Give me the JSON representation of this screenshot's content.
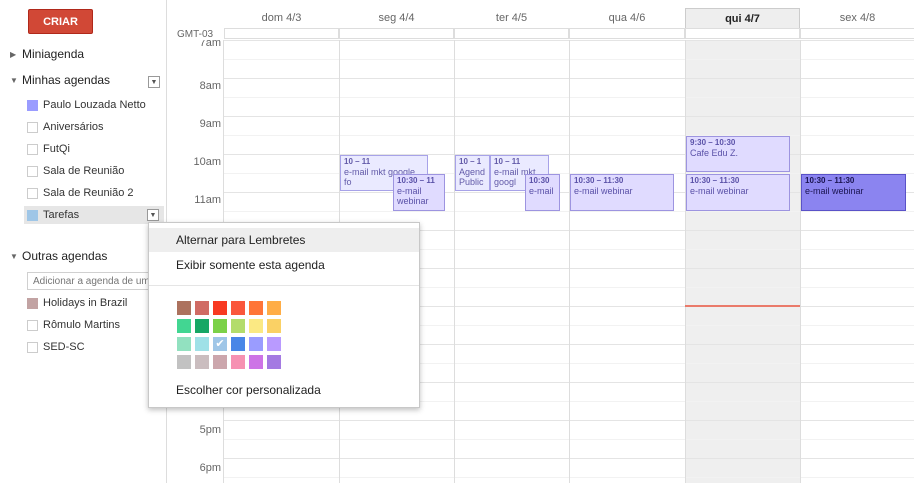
{
  "create_button": "CRIAR",
  "sidebar": {
    "mini_calendar": "Miniagenda",
    "my_calendars": "Minhas agendas",
    "calendars": [
      {
        "label": "Paulo Louzada Netto",
        "color": "#9a9cff"
      },
      {
        "label": "Aniversários",
        "color": ""
      },
      {
        "label": "FutQi",
        "color": ""
      },
      {
        "label": "Sala de Reunião",
        "color": ""
      },
      {
        "label": "Sala de Reunião 2",
        "color": ""
      },
      {
        "label": "Tarefas",
        "color": "#9fc6e7"
      }
    ],
    "other_calendars": "Outras agendas",
    "add_placeholder": "Adicionar a agenda de um",
    "others": [
      {
        "label": "Holidays in Brazil",
        "color": "#c2a3a3"
      },
      {
        "label": "Rômulo Martins",
        "color": ""
      },
      {
        "label": "SED-SC",
        "color": ""
      }
    ]
  },
  "grid": {
    "timezone": "GMT-03",
    "days": [
      "dom 4/3",
      "seg 4/4",
      "ter 4/5",
      "qua 4/6",
      "qui 4/7",
      "sex 4/8"
    ],
    "today_index": 4,
    "hours": [
      "7am",
      "8am",
      "9am",
      "10am",
      "11am",
      "5pm",
      "6pm"
    ]
  },
  "events": [
    {
      "time": "10 – 11",
      "title": "e-mail mkt google fo"
    },
    {
      "time": "10:30 – 11",
      "title": "e-mail webinar"
    },
    {
      "time": "10 – 1",
      "title": "Agend Public"
    },
    {
      "time": "10 – 11",
      "title": "e-mail mkt googl"
    },
    {
      "time": "10:30",
      "title": "e-mail"
    },
    {
      "time": "10:30 – 11:30",
      "title": "e-mail webinar"
    },
    {
      "time": "9:30 – 10:30",
      "title": "Cafe Edu Z."
    },
    {
      "time": "10:30 – 11:30",
      "title": "e-mail webinar"
    },
    {
      "time": "10:30 – 11:30",
      "title": "e-mail webinar"
    }
  ],
  "menu": {
    "item1": "Alternar para Lembretes",
    "item2": "Exibir somente esta agenda",
    "custom_color": "Escolher cor personalizada",
    "colors": [
      [
        "#ac725e",
        "#d06b64",
        "#f83a22",
        "#fa573c",
        "#ff7537",
        "#ffad46"
      ],
      [
        "#42d692",
        "#16a765",
        "#7bd148",
        "#b3dc6c",
        "#fbe983",
        "#fad165"
      ],
      [
        "#92e1c0",
        "#9fe1e7",
        "#9fc6e7",
        "#4986e7",
        "#9a9cff",
        "#b99aff"
      ],
      [
        "#c2c2c2",
        "#cabdbf",
        "#cca6ac",
        "#f691b2",
        "#cd74e6",
        "#a47ae2"
      ]
    ],
    "selected_color": "#9fc6e7"
  }
}
